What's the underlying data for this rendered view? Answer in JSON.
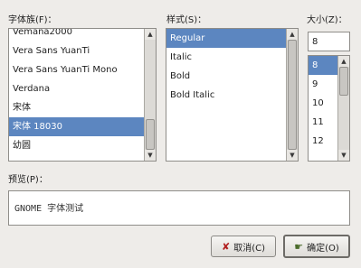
{
  "family": {
    "label": "字体族(F)：",
    "items": [
      {
        "label": "Vemana2000",
        "selected": false
      },
      {
        "label": "Vera Sans YuanTi",
        "selected": false
      },
      {
        "label": "Vera Sans YuanTi Mono",
        "selected": false
      },
      {
        "label": "Verdana",
        "selected": false
      },
      {
        "label": "宋体",
        "selected": false
      },
      {
        "label": "宋体 18030",
        "selected": true
      },
      {
        "label": "幼圆",
        "selected": false
      }
    ]
  },
  "style": {
    "label": "样式(S)：",
    "items": [
      {
        "label": "Regular",
        "selected": true
      },
      {
        "label": "Italic",
        "selected": false
      },
      {
        "label": "Bold",
        "selected": false
      },
      {
        "label": "Bold Italic",
        "selected": false
      }
    ]
  },
  "size": {
    "label": "大小(Z)：",
    "value": "8",
    "items": [
      {
        "label": "8",
        "selected": true
      },
      {
        "label": "9",
        "selected": false
      },
      {
        "label": "10",
        "selected": false
      },
      {
        "label": "11",
        "selected": false
      },
      {
        "label": "12",
        "selected": false
      }
    ]
  },
  "preview": {
    "label": "预览(P)：",
    "text": "GNOME 字体测试"
  },
  "buttons": {
    "cancel": "取消(C)",
    "ok": "确定(O)"
  }
}
